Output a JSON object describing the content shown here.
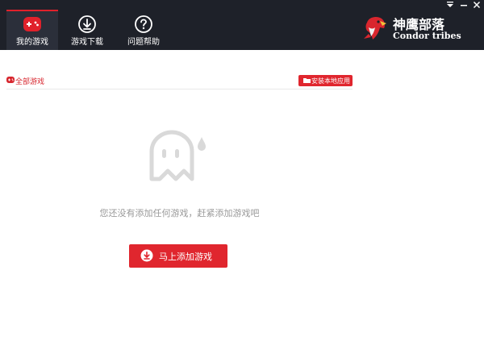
{
  "nav": {
    "items": [
      {
        "label": "我的游戏",
        "icon": "gamepad-icon",
        "active": true
      },
      {
        "label": "游戏下载",
        "icon": "download-circle-icon",
        "active": false
      },
      {
        "label": "问题帮助",
        "icon": "help-circle-icon",
        "active": false
      }
    ]
  },
  "window_controls": [
    "dropdown-menu-icon",
    "minimize-icon",
    "close-icon"
  ],
  "brand": {
    "name_cn": "神鹰部落",
    "name_en": "Condor tribes",
    "logo_icon": "eagle-logo-icon"
  },
  "filter": {
    "label": "全部游戏",
    "install_local_label": "安装本地应用"
  },
  "empty_state": {
    "icon": "ghost-icon",
    "message": "您还没有添加任何游戏，赶紧添加游戏吧"
  },
  "add_button": {
    "label": "马上添加游戏",
    "icon": "download-icon"
  },
  "colors": {
    "topbar": "#1e2129",
    "accent": "#e0262e",
    "muted_text": "#999999",
    "ghost": "#d9d9d9"
  }
}
